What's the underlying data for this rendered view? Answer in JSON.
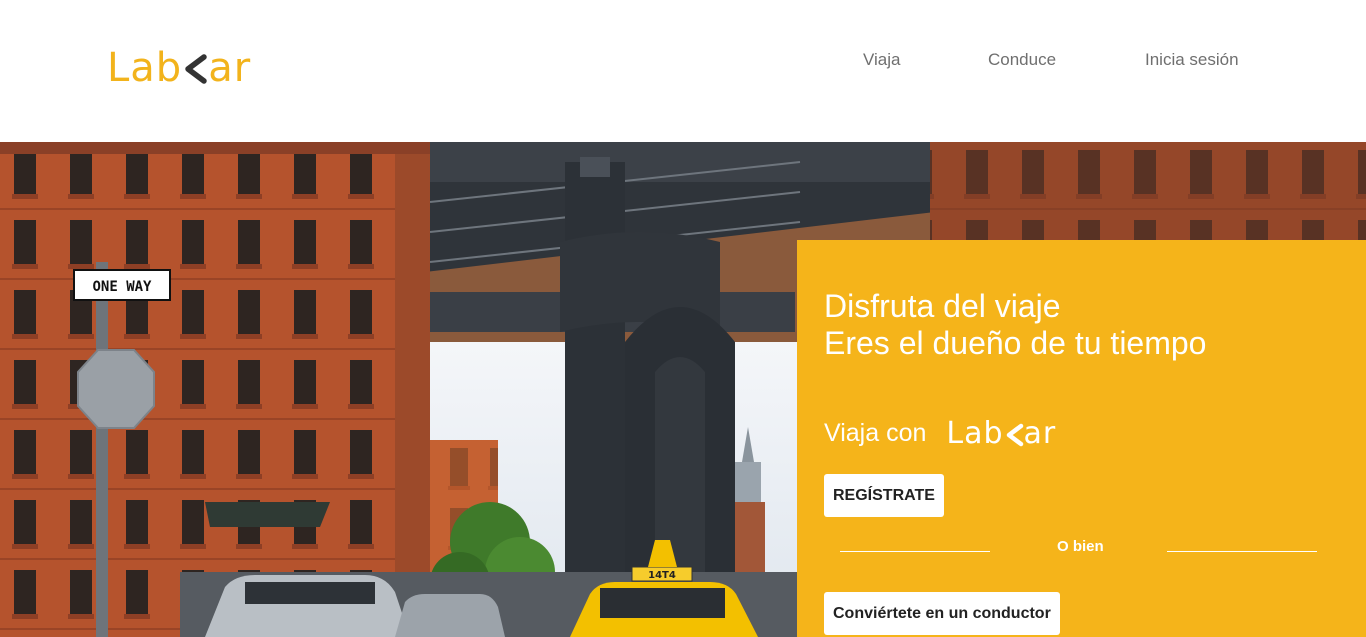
{
  "header": {
    "logo_left": "Lab",
    "logo_right": "ar",
    "nav": [
      {
        "label": "Viaja"
      },
      {
        "label": "Conduce"
      },
      {
        "label": "Inicia sesión"
      }
    ]
  },
  "hero": {
    "headline_line1": "Disfruta del viaje",
    "headline_line2": "Eres el dueño de tu tiempo",
    "viaja_con": "Viaja con",
    "logo_left": "Lab",
    "logo_right": "ar",
    "register_label": "REGÍSTRATE",
    "or_label": "O bien",
    "driver_label": "Conviértete en un conductor"
  },
  "scene": {
    "sign_text": "ONE WAY",
    "taxi_number": "14T4"
  },
  "colors": {
    "brand_yellow": "#f5b41a",
    "logo_yellow": "#f2b31c",
    "logo_dark": "#333333",
    "nav_gray": "#6f6f6f"
  }
}
